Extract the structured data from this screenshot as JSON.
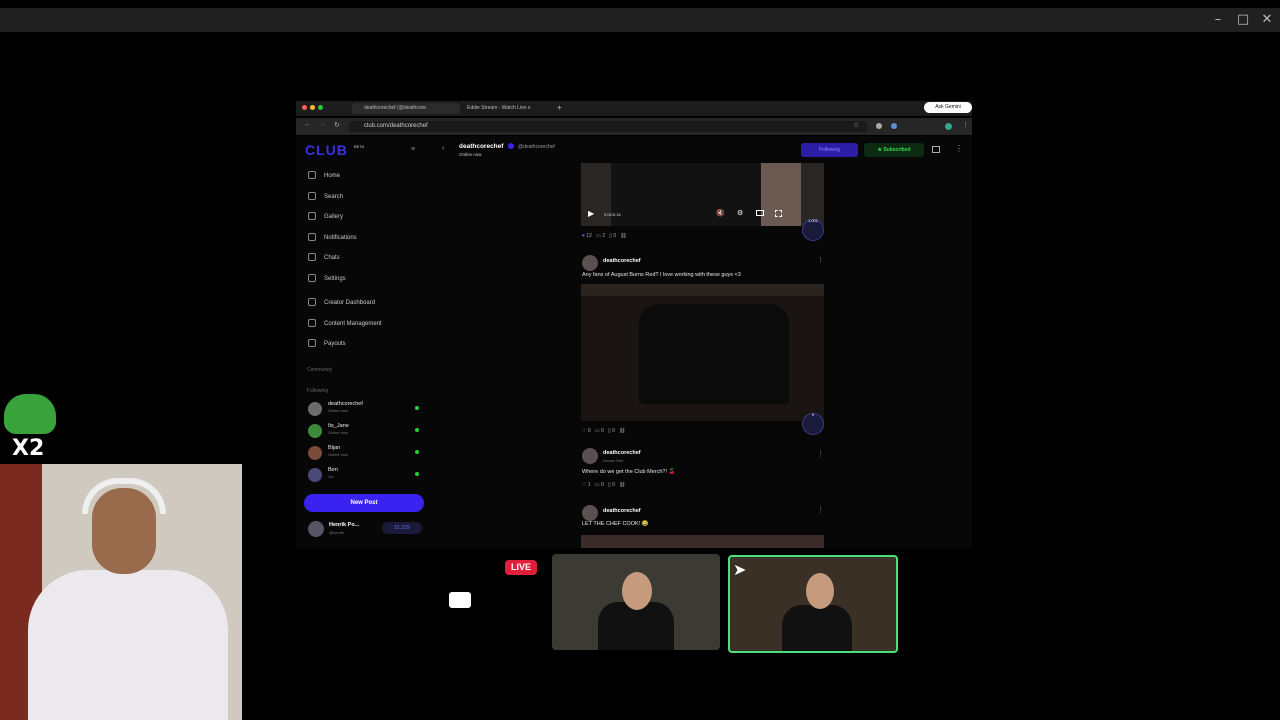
{
  "browser": {
    "tabs": [
      {
        "label": "deathcorechef (@deathcore"
      },
      {
        "label": "Eddie Stream - Watch Live o"
      }
    ],
    "url": "club.com/deathcorechef",
    "ask_button": "Ask Gemini"
  },
  "site": {
    "logo": "CLUB",
    "logo_sup": "BETA",
    "nav": [
      {
        "label": "Home",
        "icon": "home-icon"
      },
      {
        "label": "Search",
        "icon": "search-icon"
      },
      {
        "label": "Gallery",
        "icon": "gallery-icon"
      },
      {
        "label": "Notifications",
        "icon": "bell-icon"
      },
      {
        "label": "Chats",
        "icon": "chat-icon"
      },
      {
        "label": "Settings",
        "icon": "gear-icon"
      },
      {
        "label": "Creator Dashboard",
        "icon": "dashboard-icon"
      },
      {
        "label": "Content Management",
        "icon": "content-icon"
      },
      {
        "label": "Payouts",
        "icon": "payout-icon"
      }
    ],
    "community_label": "Community",
    "following_label": "Following",
    "following": [
      {
        "name": "deathcorechef",
        "status": "Online now"
      },
      {
        "name": "Its_Jane",
        "status": "Online now"
      },
      {
        "name": "Bijan",
        "status": "Online now"
      },
      {
        "name": "Ben",
        "status": "1m"
      }
    ],
    "new_post": "New Post",
    "me": {
      "name": "Henrik Po...",
      "handle": "@henrik",
      "balance": "51,229"
    }
  },
  "profile": {
    "name": "deathcorechef",
    "handle": "@deathcorechef",
    "status": "Online now",
    "following_button": "Following",
    "subscribed_button": "Subscribed"
  },
  "feed": {
    "video": {
      "time": "0:02/0:16",
      "badge": "1,001",
      "likes": "12",
      "comments": "2",
      "saves": "0"
    },
    "posts": [
      {
        "author": "deathcorechef",
        "text": "Any fans of August Burns Red? I love working with these guys <3",
        "likes": "0",
        "comments": "0",
        "saves": "0",
        "badge": "0"
      },
      {
        "author": "deathcorechef",
        "sub": "Dream Hub",
        "text": "Where do we get the Club Merch?! 🍒",
        "likes": "1",
        "comments": "0",
        "saves": "0"
      },
      {
        "author": "deathcorechef",
        "text": "LET THE CHEF COOK! 😂"
      }
    ]
  },
  "overlay": {
    "live": "LIVE",
    "x2": "X2"
  },
  "colors": {
    "accent": "#3a22f0",
    "subscribed": "#2ee04a",
    "live": "#e0203a",
    "online": "#1fcf3a"
  }
}
